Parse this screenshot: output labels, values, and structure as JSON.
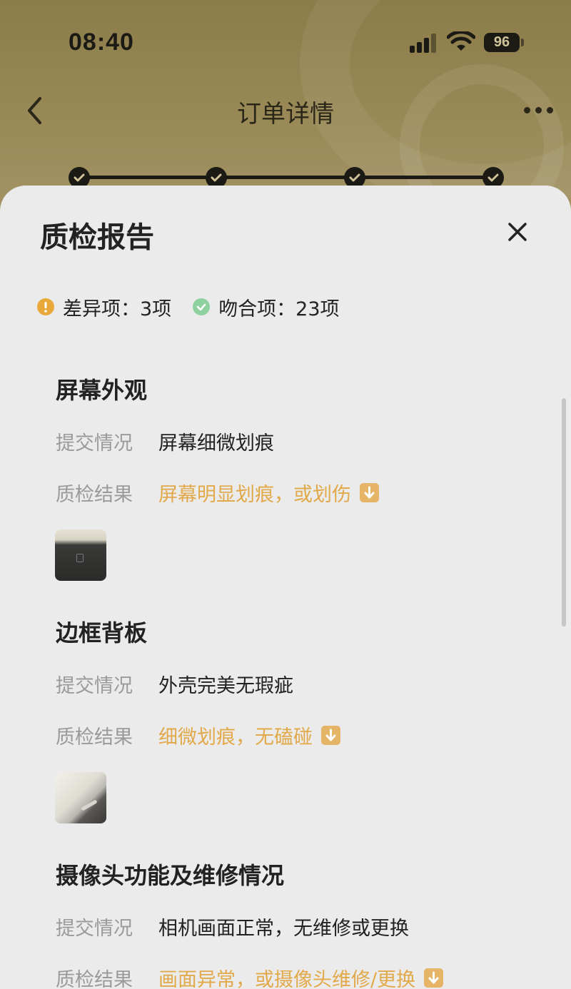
{
  "status_bar": {
    "time": "08:40",
    "battery": "96"
  },
  "nav": {
    "title": "订单详情"
  },
  "progress": {
    "steps": 4,
    "completed": 4
  },
  "sheet": {
    "title": "质检报告",
    "summary": {
      "diff_text": "差异项：3项",
      "match_text": "吻合项：23项"
    }
  },
  "sections": [
    {
      "title": "屏幕外观",
      "submitted_label": "提交情况",
      "submitted_value": "屏幕细微划痕",
      "result_label": "质检结果",
      "result_value": "屏幕明显划痕，或划伤"
    },
    {
      "title": "边框背板",
      "submitted_label": "提交情况",
      "submitted_value": "外壳完美无瑕疵",
      "result_label": "质检结果",
      "result_value": "细微划痕，无磕碰"
    },
    {
      "title": "摄像头功能及维修情况",
      "submitted_label": "提交情况",
      "submitted_value": "相机画面正常，无维修或更换",
      "result_label": "质检结果",
      "result_value": "画面异常，或摄像头维修/更换"
    }
  ],
  "colors": {
    "accent": "#e2a94a",
    "ok": "#8fd19e",
    "warn": "#e9a93a"
  }
}
